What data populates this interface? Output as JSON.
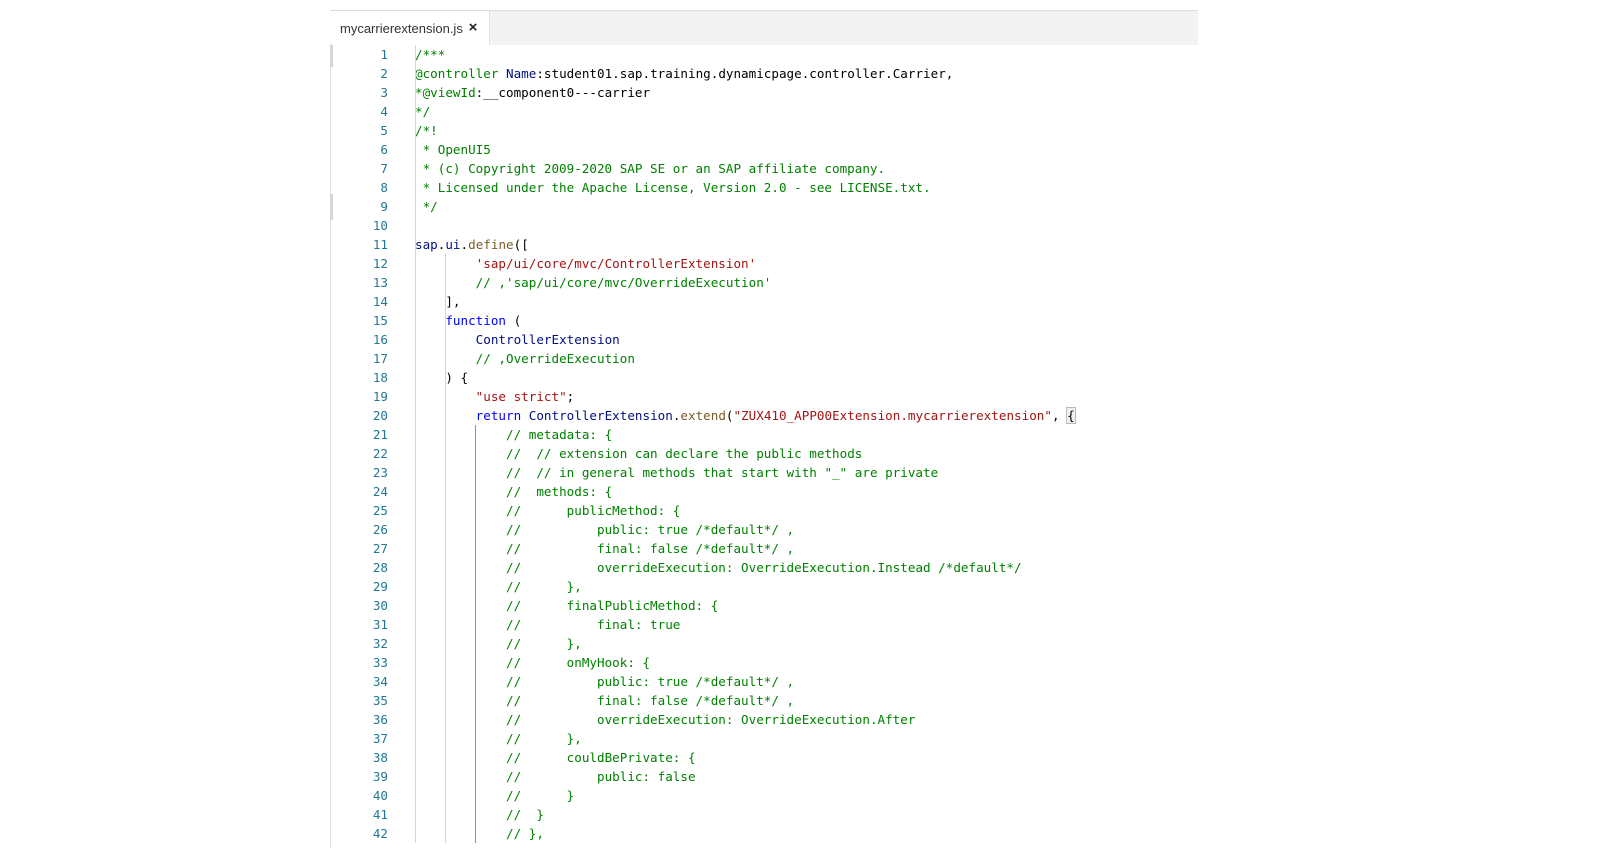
{
  "editor": {
    "tab": {
      "label": "mycarrierextension.js",
      "close_glyph": "×"
    },
    "lines": [
      {
        "n": "1",
        "tokens": [
          [
            "c",
            "/***"
          ]
        ]
      },
      {
        "n": "2",
        "tokens": [
          [
            "c",
            "@controller "
          ],
          [
            "v",
            "Name"
          ],
          [
            "p",
            ":student01.sap.training.dynamicpage.controller.Carrier,"
          ]
        ]
      },
      {
        "n": "3",
        "tokens": [
          [
            "c",
            "*@viewId"
          ],
          [
            "p",
            ":__component0---carrier"
          ]
        ]
      },
      {
        "n": "4",
        "tokens": [
          [
            "c",
            "*/"
          ]
        ]
      },
      {
        "n": "5",
        "tokens": [
          [
            "c",
            "/*!"
          ]
        ]
      },
      {
        "n": "6",
        "tokens": [
          [
            "c",
            " * OpenUI5"
          ]
        ]
      },
      {
        "n": "7",
        "tokens": [
          [
            "c",
            " * (c) Copyright 2009-2020 SAP SE or an SAP affiliate company."
          ]
        ]
      },
      {
        "n": "8",
        "tokens": [
          [
            "c",
            " * Licensed under the Apache License, Version 2.0 - see LICENSE.txt."
          ]
        ]
      },
      {
        "n": "9",
        "tokens": [
          [
            "c",
            " */"
          ]
        ]
      },
      {
        "n": "10",
        "tokens": []
      },
      {
        "n": "11",
        "tokens": [
          [
            "v",
            "sap"
          ],
          [
            "p",
            "."
          ],
          [
            "v",
            "ui"
          ],
          [
            "p",
            "."
          ],
          [
            "f",
            "define"
          ],
          [
            "p",
            "(["
          ]
        ]
      },
      {
        "n": "12",
        "tokens": [
          [
            "p",
            "        "
          ],
          [
            "s",
            "'sap/ui/core/mvc/ControllerExtension'"
          ]
        ]
      },
      {
        "n": "13",
        "tokens": [
          [
            "p",
            "        "
          ],
          [
            "c",
            "// ,'sap/ui/core/mvc/OverrideExecution'"
          ]
        ]
      },
      {
        "n": "14",
        "tokens": [
          [
            "p",
            "    ],"
          ]
        ]
      },
      {
        "n": "15",
        "tokens": [
          [
            "p",
            "    "
          ],
          [
            "k",
            "function"
          ],
          [
            "p",
            " ("
          ]
        ]
      },
      {
        "n": "16",
        "tokens": [
          [
            "p",
            "        "
          ],
          [
            "v",
            "ControllerExtension"
          ]
        ]
      },
      {
        "n": "17",
        "tokens": [
          [
            "p",
            "        "
          ],
          [
            "c",
            "// ,OverrideExecution"
          ]
        ]
      },
      {
        "n": "18",
        "tokens": [
          [
            "p",
            "    ) {"
          ]
        ]
      },
      {
        "n": "19",
        "tokens": [
          [
            "p",
            "        "
          ],
          [
            "s",
            "\"use strict\""
          ],
          [
            "p",
            ";"
          ]
        ]
      },
      {
        "n": "20",
        "tokens": [
          [
            "p",
            "        "
          ],
          [
            "k",
            "return"
          ],
          [
            "p",
            " "
          ],
          [
            "v",
            "ControllerExtension"
          ],
          [
            "p",
            "."
          ],
          [
            "f",
            "extend"
          ],
          [
            "p",
            "("
          ],
          [
            "s",
            "\"ZUX410_APP00Extension.mycarrierextension\""
          ],
          [
            "p",
            ", "
          ],
          [
            "hl",
            "{"
          ]
        ]
      },
      {
        "n": "21",
        "tokens": [
          [
            "p",
            "            "
          ],
          [
            "c",
            "// metadata: {"
          ]
        ]
      },
      {
        "n": "22",
        "tokens": [
          [
            "p",
            "            "
          ],
          [
            "c",
            "//  // extension can declare the public methods"
          ]
        ]
      },
      {
        "n": "23",
        "tokens": [
          [
            "p",
            "            "
          ],
          [
            "c",
            "//  // in general methods that start with \"_\" are private"
          ]
        ]
      },
      {
        "n": "24",
        "tokens": [
          [
            "p",
            "            "
          ],
          [
            "c",
            "//  methods: {"
          ]
        ]
      },
      {
        "n": "25",
        "tokens": [
          [
            "p",
            "            "
          ],
          [
            "c",
            "//      publicMethod: {"
          ]
        ]
      },
      {
        "n": "26",
        "tokens": [
          [
            "p",
            "            "
          ],
          [
            "c",
            "//          public: true /*default*/ ,"
          ]
        ]
      },
      {
        "n": "27",
        "tokens": [
          [
            "p",
            "            "
          ],
          [
            "c",
            "//          final: false /*default*/ ,"
          ]
        ]
      },
      {
        "n": "28",
        "tokens": [
          [
            "p",
            "            "
          ],
          [
            "c",
            "//          overrideExecution: OverrideExecution.Instead /*default*/"
          ]
        ]
      },
      {
        "n": "29",
        "tokens": [
          [
            "p",
            "            "
          ],
          [
            "c",
            "//      },"
          ]
        ]
      },
      {
        "n": "30",
        "tokens": [
          [
            "p",
            "            "
          ],
          [
            "c",
            "//      finalPublicMethod: {"
          ]
        ]
      },
      {
        "n": "31",
        "tokens": [
          [
            "p",
            "            "
          ],
          [
            "c",
            "//          final: true"
          ]
        ]
      },
      {
        "n": "32",
        "tokens": [
          [
            "p",
            "            "
          ],
          [
            "c",
            "//      },"
          ]
        ]
      },
      {
        "n": "33",
        "tokens": [
          [
            "p",
            "            "
          ],
          [
            "c",
            "//      onMyHook: {"
          ]
        ]
      },
      {
        "n": "34",
        "tokens": [
          [
            "p",
            "            "
          ],
          [
            "c",
            "//          public: true /*default*/ ,"
          ]
        ]
      },
      {
        "n": "35",
        "tokens": [
          [
            "p",
            "            "
          ],
          [
            "c",
            "//          final: false /*default*/ ,"
          ]
        ]
      },
      {
        "n": "36",
        "tokens": [
          [
            "p",
            "            "
          ],
          [
            "c",
            "//          overrideExecution: OverrideExecution.After"
          ]
        ]
      },
      {
        "n": "37",
        "tokens": [
          [
            "p",
            "            "
          ],
          [
            "c",
            "//      },"
          ]
        ]
      },
      {
        "n": "38",
        "tokens": [
          [
            "p",
            "            "
          ],
          [
            "c",
            "//      couldBePrivate: {"
          ]
        ]
      },
      {
        "n": "39",
        "tokens": [
          [
            "p",
            "            "
          ],
          [
            "c",
            "//          public: false"
          ]
        ]
      },
      {
        "n": "40",
        "tokens": [
          [
            "p",
            "            "
          ],
          [
            "c",
            "//      }"
          ]
        ]
      },
      {
        "n": "41",
        "tokens": [
          [
            "p",
            "            "
          ],
          [
            "c",
            "//  }"
          ]
        ]
      },
      {
        "n": "42",
        "tokens": [
          [
            "p",
            "            "
          ],
          [
            "c",
            "// },"
          ]
        ]
      }
    ]
  },
  "colors": {
    "comment": "#008000",
    "string": "#a31515",
    "keyword": "#0000ff",
    "function": "#795e26",
    "variable": "#001080",
    "line_number": "#237893"
  }
}
